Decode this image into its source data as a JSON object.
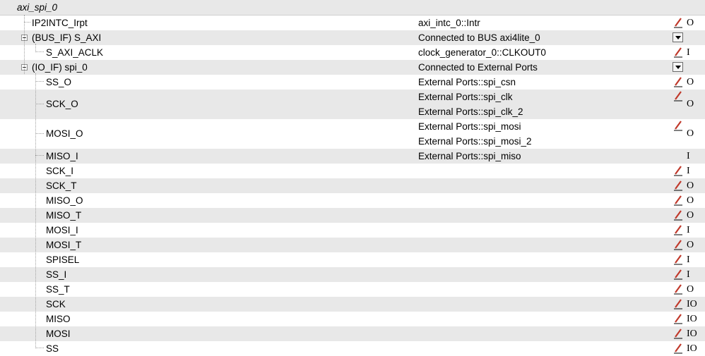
{
  "tree": {
    "root": {
      "label": "axi_spi_0"
    },
    "rows": [
      {
        "label": "IP2INTC_Irpt",
        "connections": [
          "axi_intc_0::Intr"
        ],
        "direction": "O",
        "editable": true
      },
      {
        "label": "(BUS_IF) S_AXI",
        "connections": [
          "Connected to BUS axi4lite_0"
        ],
        "direction": "",
        "dropdown": true
      },
      {
        "label": "S_AXI_ACLK",
        "connections": [
          "clock_generator_0::CLKOUT0"
        ],
        "direction": "I",
        "editable": true
      },
      {
        "label": "(IO_IF) spi_0",
        "connections": [
          "Connected to External Ports"
        ],
        "direction": "",
        "dropdown": true
      },
      {
        "label": "SS_O",
        "connections": [
          "External Ports::spi_csn"
        ],
        "direction": "O",
        "editable": true
      },
      {
        "label": "SCK_O",
        "connections": [
          "External Ports::spi_clk",
          "External Ports::spi_clk_2"
        ],
        "direction": "O",
        "editable": true
      },
      {
        "label": "MOSI_O",
        "connections": [
          "External Ports::spi_mosi",
          "External Ports::spi_mosi_2"
        ],
        "direction": "O",
        "editable": true
      },
      {
        "label": "MISO_I",
        "connections": [
          "External Ports::spi_miso"
        ],
        "direction": "I",
        "editable": false
      },
      {
        "label": "SCK_I",
        "connections": [],
        "direction": "I",
        "editable": true
      },
      {
        "label": "SCK_T",
        "connections": [],
        "direction": "O",
        "editable": true
      },
      {
        "label": "MISO_O",
        "connections": [],
        "direction": "O",
        "editable": true
      },
      {
        "label": "MISO_T",
        "connections": [],
        "direction": "O",
        "editable": true
      },
      {
        "label": "MOSI_I",
        "connections": [],
        "direction": "I",
        "editable": true
      },
      {
        "label": "MOSI_T",
        "connections": [],
        "direction": "O",
        "editable": true
      },
      {
        "label": "SPISEL",
        "connections": [],
        "direction": "I",
        "editable": true
      },
      {
        "label": "SS_I",
        "connections": [],
        "direction": "I",
        "editable": true
      },
      {
        "label": "SS_T",
        "connections": [],
        "direction": "O",
        "editable": true
      },
      {
        "label": "SCK",
        "connections": [],
        "direction": "IO",
        "editable": true
      },
      {
        "label": "MISO",
        "connections": [],
        "direction": "IO",
        "editable": true
      },
      {
        "label": "MOSI",
        "connections": [],
        "direction": "IO",
        "editable": true
      },
      {
        "label": "SS",
        "connections": [],
        "direction": "IO",
        "editable": true
      }
    ]
  },
  "icons": {
    "edit": "pencil-icon",
    "dropdown": "dropdown-arrow-icon",
    "expander": "collapse-minus-icon"
  },
  "colors": {
    "row_shade": "#e8e8e8",
    "pencil": "#c0392b"
  }
}
